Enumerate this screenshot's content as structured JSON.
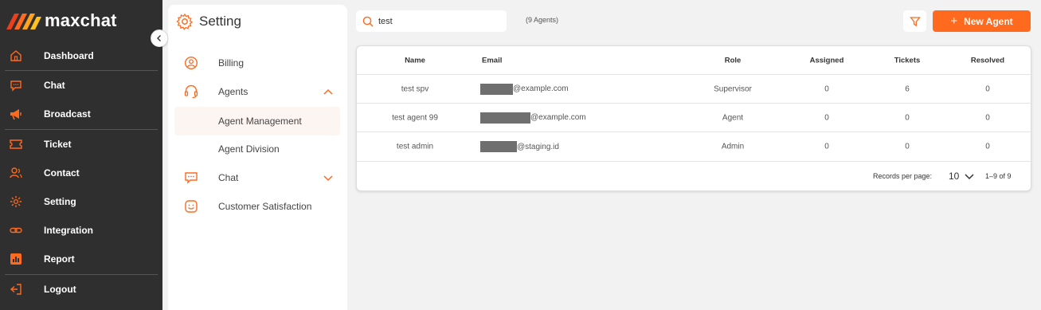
{
  "app": {
    "name": "maxchat",
    "brand_color": "#ff6a1f"
  },
  "sidebar": {
    "items": [
      {
        "label": "Dashboard",
        "icon": "home-icon"
      },
      {
        "label": "Chat",
        "icon": "chat-icon"
      },
      {
        "label": "Broadcast",
        "icon": "megaphone-icon"
      },
      {
        "label": "Ticket",
        "icon": "ticket-icon"
      },
      {
        "label": "Contact",
        "icon": "contact-icon"
      },
      {
        "label": "Setting",
        "icon": "gear-icon"
      },
      {
        "label": "Integration",
        "icon": "link-icon"
      },
      {
        "label": "Report",
        "icon": "report-icon"
      },
      {
        "label": "Logout",
        "icon": "logout-icon"
      }
    ]
  },
  "settings": {
    "title": "Setting",
    "menu": {
      "billing": "Billing",
      "agents": "Agents",
      "agent_management": "Agent Management",
      "agent_division": "Agent Division",
      "chat": "Chat",
      "customer_satisfaction": "Customer Satisfaction"
    }
  },
  "search": {
    "value": "test",
    "agent_count": "(9 Agents)"
  },
  "toolbar": {
    "new_agent_label": "New Agent"
  },
  "table": {
    "headers": {
      "name": "Name",
      "email": "Email",
      "role": "Role",
      "assigned": "Assigned",
      "tickets": "Tickets",
      "resolved": "Resolved"
    },
    "rows": [
      {
        "name": "test spv",
        "email_domain": "@example.com",
        "role": "Supervisor",
        "assigned": "0",
        "tickets": "6",
        "resolved": "0"
      },
      {
        "name": "test agent 99",
        "email_domain": "@example.com",
        "role": "Agent",
        "assigned": "0",
        "tickets": "0",
        "resolved": "0"
      },
      {
        "name": "test admin",
        "email_domain": "@staging.id",
        "role": "Admin",
        "assigned": "0",
        "tickets": "0",
        "resolved": "0"
      }
    ],
    "pagination": {
      "records_label": "Records per page:",
      "per_page": "10",
      "range": "1–9 of 9"
    }
  }
}
